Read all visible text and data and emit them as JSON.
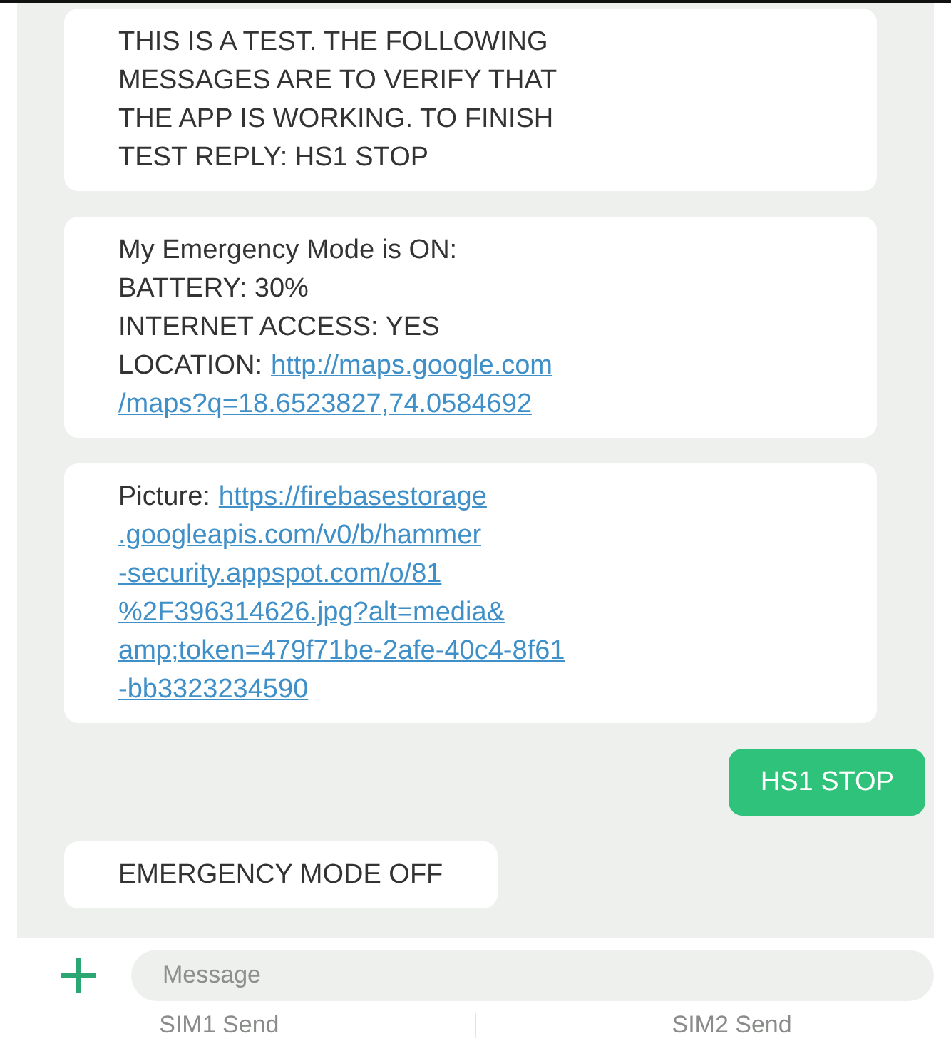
{
  "messages": [
    {
      "kind": "incoming",
      "lines": [
        {
          "text": "THIS IS A TEST. THE FOLLOWING"
        },
        {
          "text": "MESSAGES ARE TO VERIFY THAT"
        },
        {
          "text": "THE APP IS WORKING. TO FINISH"
        },
        {
          "text": "TEST REPLY: HS1 STOP"
        }
      ]
    },
    {
      "kind": "incoming",
      "lines": [
        {
          "text": "My Emergency Mode is ON:"
        },
        {
          "text": "BATTERY: 30%"
        },
        {
          "text": "INTERNET ACCESS: YES"
        },
        {
          "text": "LOCATION:",
          "link": "http://maps.google.com"
        },
        {
          "link": "/maps?q=18.6523827,74.0584692"
        }
      ]
    },
    {
      "kind": "incoming",
      "lines": [
        {
          "text": "Picture:",
          "link": "https://firebasestorage"
        },
        {
          "link": ".googleapis.com/v0/b/hammer"
        },
        {
          "link": "-security.appspot.com/o/81"
        },
        {
          "link": "%2F396314626.jpg?alt=media&"
        },
        {
          "link": "amp;token=479f71be-2afe-40c4-8f61"
        },
        {
          "link": "-bb3323234590"
        }
      ]
    },
    {
      "kind": "outgoing",
      "lines": [
        {
          "text": "HS1 STOP"
        }
      ]
    },
    {
      "kind": "incoming",
      "lines": [
        {
          "text": "EMERGENCY MODE OFF"
        }
      ]
    }
  ],
  "composer": {
    "placeholder": "Message"
  },
  "send_buttons": [
    "SIM1 Send",
    "SIM2 Send"
  ]
}
